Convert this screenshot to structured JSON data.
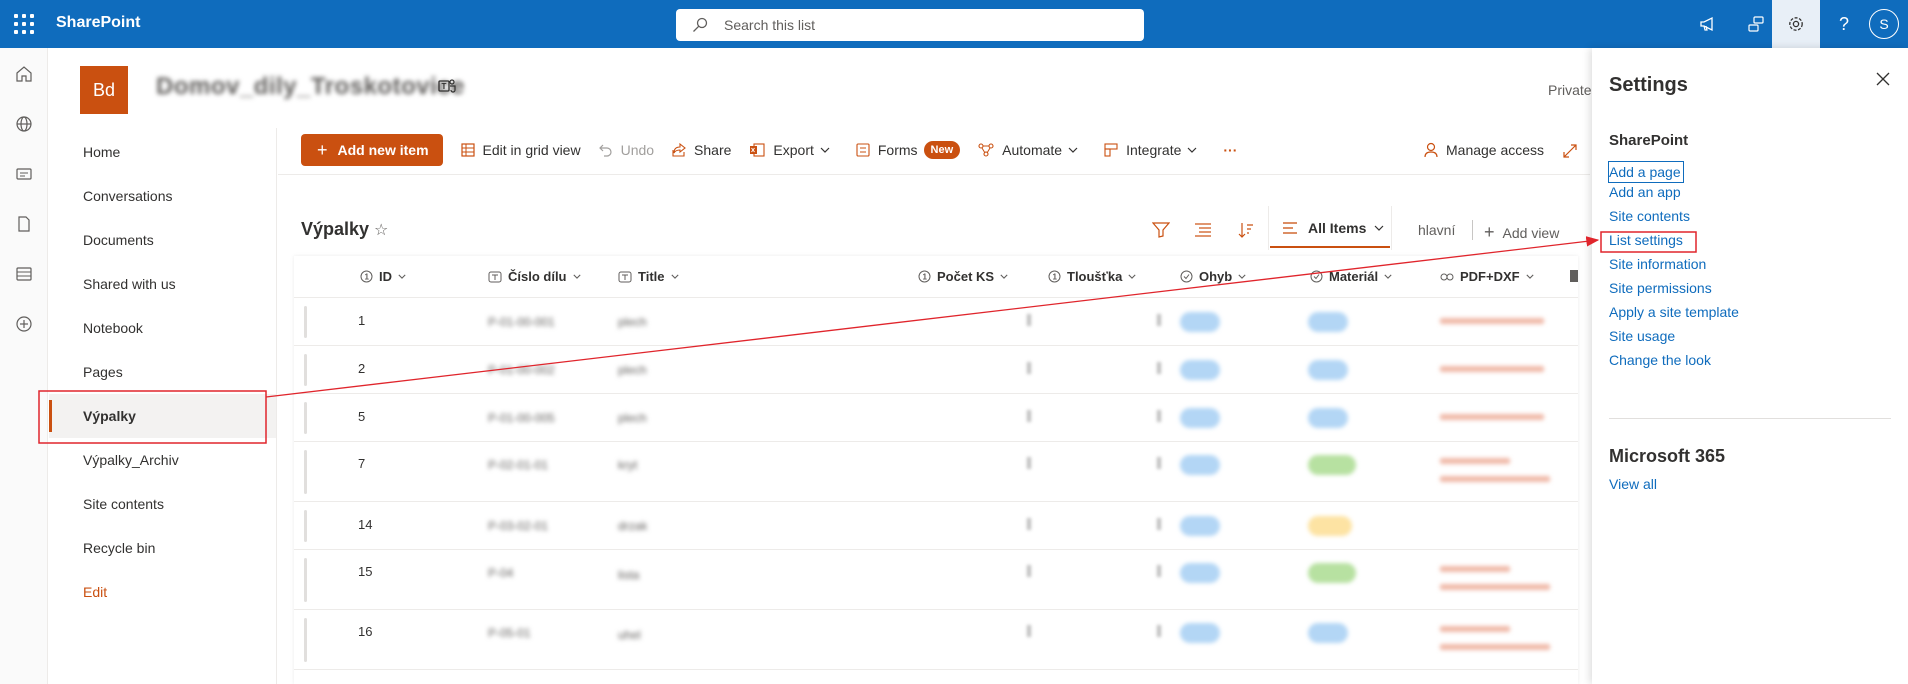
{
  "suite": {
    "app_name": "SharePoint",
    "search_placeholder": "Search this list",
    "avatar_initial": "S"
  },
  "site": {
    "logo_initials": "Bd",
    "name_blurred": "Domov_dily_Troskotovice",
    "privacy": "Private"
  },
  "left_nav": {
    "items": [
      {
        "label": "Home"
      },
      {
        "label": "Conversations"
      },
      {
        "label": "Documents"
      },
      {
        "label": "Shared with us"
      },
      {
        "label": "Notebook"
      },
      {
        "label": "Pages"
      },
      {
        "label": "Výpalky"
      },
      {
        "label": "Výpalky_Archiv"
      },
      {
        "label": "Site contents"
      },
      {
        "label": "Recycle bin"
      }
    ],
    "edit_label": "Edit"
  },
  "command_bar": {
    "add_new_item": "Add new item",
    "edit_grid": "Edit in grid view",
    "undo": "Undo",
    "share": "Share",
    "export": "Export",
    "forms": "Forms",
    "forms_badge": "New",
    "automate": "Automate",
    "integrate": "Integrate",
    "more": "···",
    "manage_access": "Manage access"
  },
  "list": {
    "title": "Výpalky",
    "views": {
      "current": "All Items",
      "other": "hlavní",
      "add_view": "Add view"
    },
    "columns": [
      {
        "label": "ID",
        "icon": "number-icon"
      },
      {
        "label": "Číslo dílu",
        "icon": "text-icon"
      },
      {
        "label": "Title",
        "icon": "text-icon"
      },
      {
        "label": "Počet KS",
        "icon": "number-icon"
      },
      {
        "label": "Tloušťka",
        "icon": "number-icon"
      },
      {
        "label": "Ohyb",
        "icon": "choice-icon"
      },
      {
        "label": "Materiál",
        "icon": "choice-icon"
      },
      {
        "label": "PDF+DXF",
        "icon": "link-icon"
      }
    ],
    "rows": [
      {
        "id": "1",
        "cislo": "P-01-00-001",
        "title": "plech",
        "material": "blue",
        "link": true
      },
      {
        "id": "2",
        "cislo": "P-01-00-002",
        "title": "plech",
        "material": "blue",
        "link": true
      },
      {
        "id": "5",
        "cislo": "P-01-00-005",
        "title": "plech",
        "material": "blue",
        "link": true
      },
      {
        "id": "7",
        "cislo": "P-02-01-01",
        "title": "kryt",
        "material": "green",
        "link": true
      },
      {
        "id": "14",
        "cislo": "P-03-02-01",
        "title": "drzak",
        "material": "yellow",
        "link": false
      },
      {
        "id": "15",
        "cislo": "P-04",
        "title": "lista",
        "material": "green",
        "link": true
      },
      {
        "id": "16",
        "cislo": "P-05-01",
        "title": "uhel",
        "material": "blue",
        "link": true
      }
    ]
  },
  "settings": {
    "title": "Settings",
    "sharepoint_heading": "SharePoint",
    "links": [
      {
        "label": "Add a page"
      },
      {
        "label": "Add an app"
      },
      {
        "label": "Site contents"
      },
      {
        "label": "List settings"
      },
      {
        "label": "Site information"
      },
      {
        "label": "Site permissions"
      },
      {
        "label": "Apply a site template"
      },
      {
        "label": "Site usage"
      },
      {
        "label": "Change the look"
      }
    ],
    "m365_heading": "Microsoft 365",
    "view_all": "View all"
  },
  "colors": {
    "suite_blue": "#0f6cbd",
    "accent_orange": "#ca5010",
    "annotation_red": "#e0252c"
  }
}
